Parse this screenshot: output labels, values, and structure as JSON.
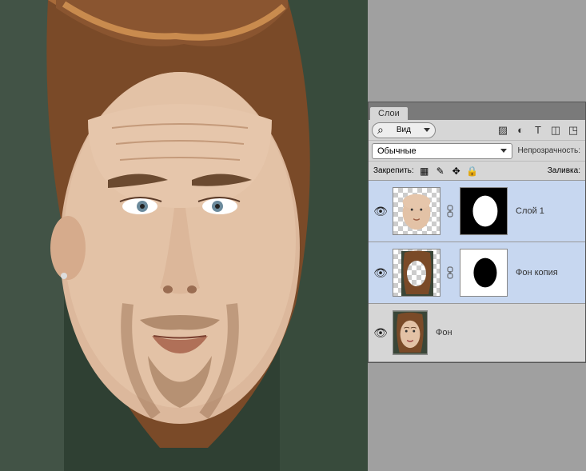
{
  "panel": {
    "tab": "Слои",
    "filter": {
      "label": "Вид"
    },
    "blend": {
      "mode": "Обычные"
    },
    "opacity_label": "Непрозрачность:",
    "lock_label": "Закрепить:",
    "fill_label": "Заливка:"
  },
  "layers": [
    {
      "name": "Слой 1",
      "visible": true,
      "has_mask": true,
      "mask_type": "white-oval-on-black",
      "selected": true
    },
    {
      "name": "Фон копия",
      "visible": true,
      "has_mask": true,
      "mask_type": "black-oval-on-white",
      "selected": true
    },
    {
      "name": "Фон",
      "visible": true,
      "has_mask": false,
      "selected": false
    }
  ]
}
